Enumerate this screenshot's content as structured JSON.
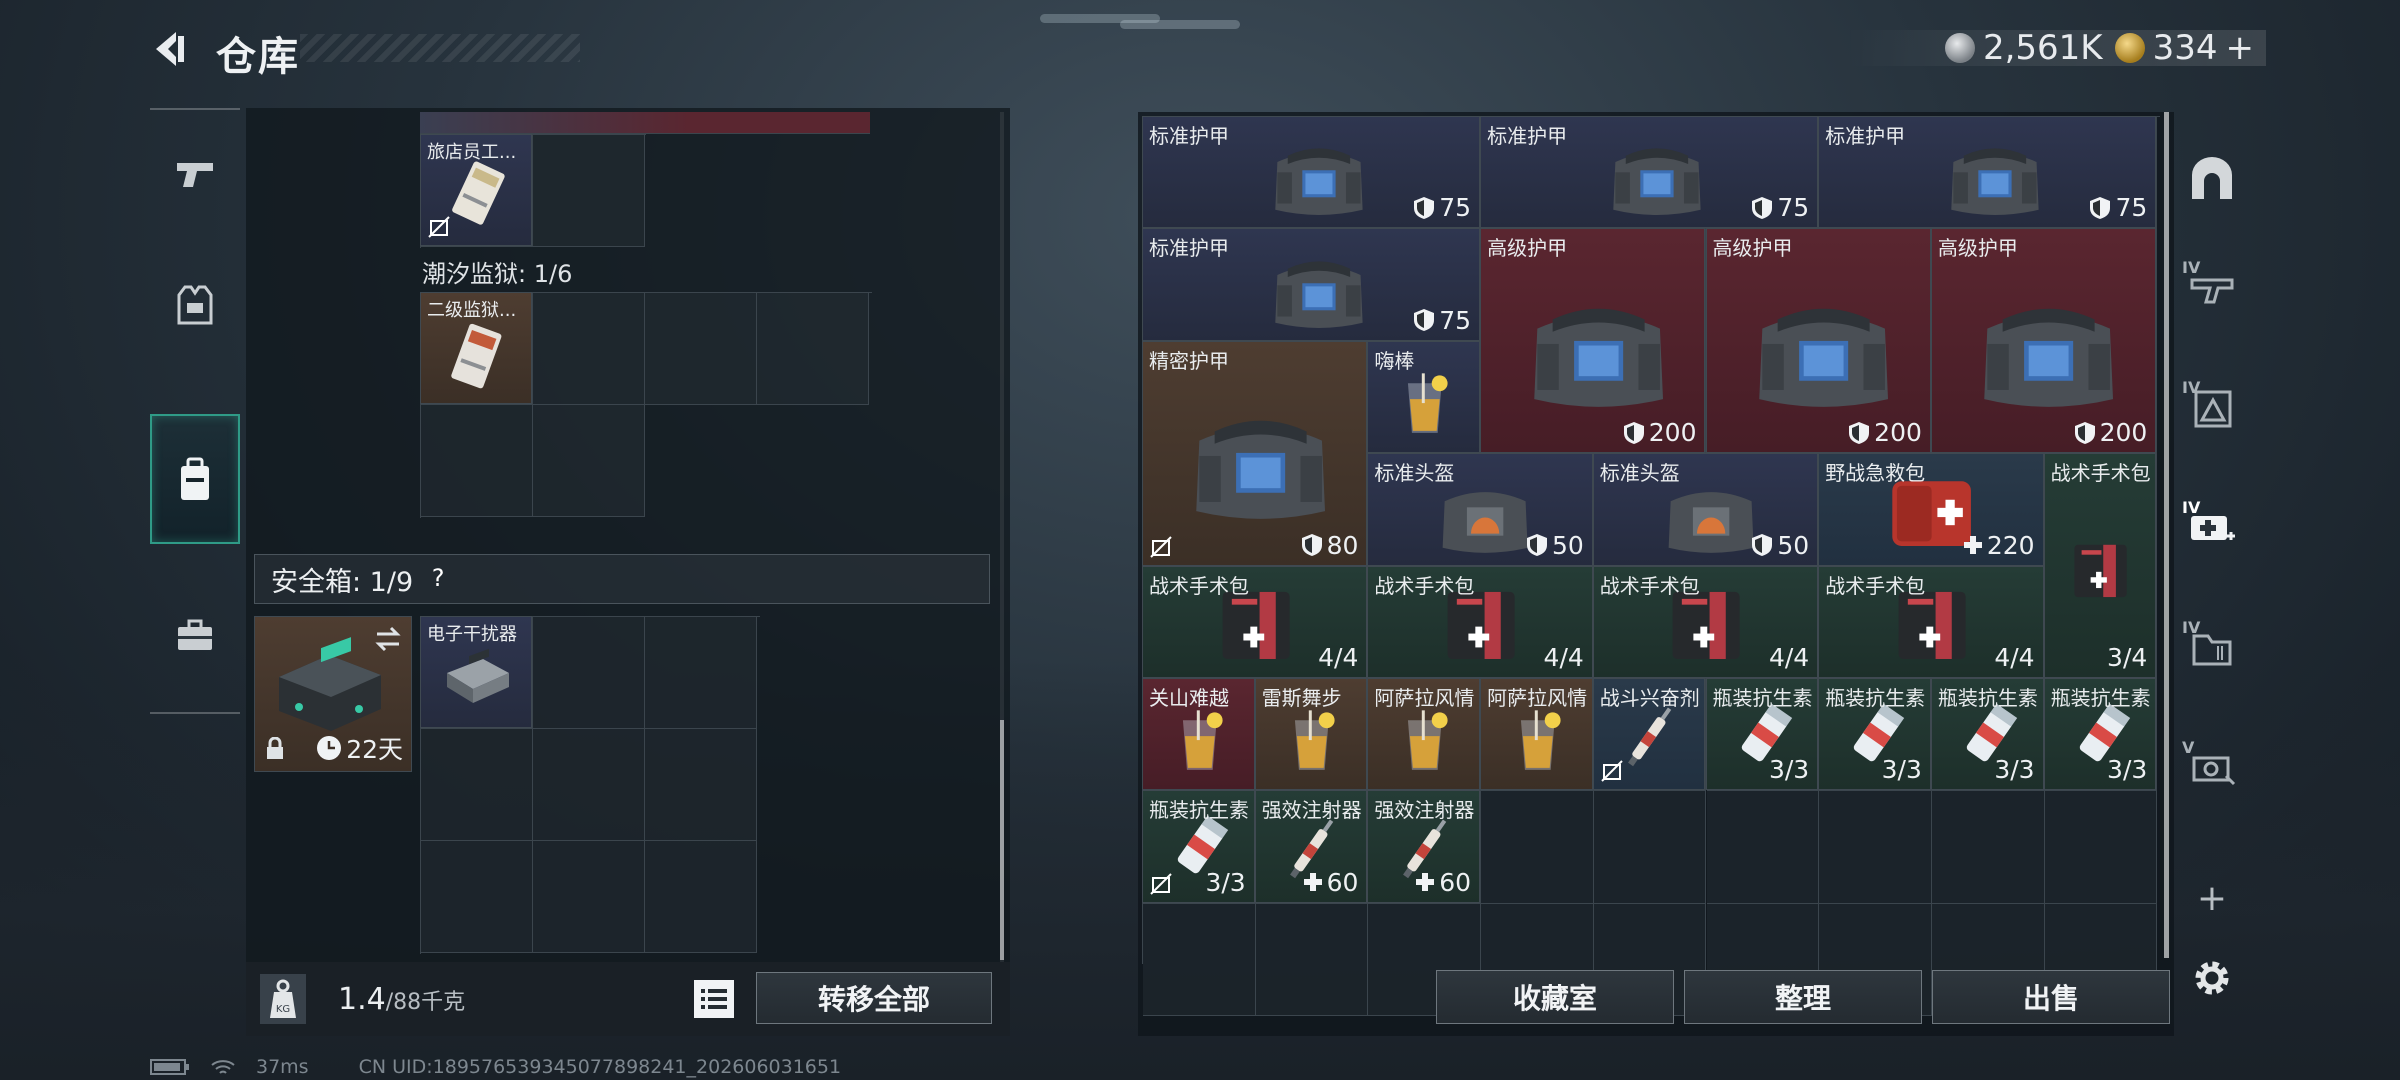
{
  "header": {
    "title": "仓库",
    "currency_silver": "2,561K",
    "currency_gold": "334",
    "add_symbol": "+"
  },
  "left_sidebar": {
    "tabs": [
      {
        "key": "weapons",
        "icon": "pistol-icon"
      },
      {
        "key": "gear",
        "icon": "vest-icon"
      },
      {
        "key": "backpack",
        "icon": "backpack-icon",
        "active": true
      },
      {
        "key": "case",
        "icon": "briefcase-icon"
      }
    ]
  },
  "left_panel": {
    "items": [
      {
        "name": "旅店员工..."
      },
      {
        "name": "二级监狱..."
      }
    ],
    "prison_section": "潮汐监狱: 1/6",
    "safe_box": {
      "label": "安全箱: 1/9",
      "help": "?",
      "duration": "22天",
      "item_name": "电子干扰器"
    },
    "weight_value": "1.4",
    "weight_total": "/88千克",
    "transfer_all": "转移全部"
  },
  "right_panel": {
    "items": [
      {
        "name": "标准护甲",
        "value": "75",
        "kind": "armor",
        "bg": "blue"
      },
      {
        "name": "标准护甲",
        "value": "75",
        "kind": "armor",
        "bg": "blue"
      },
      {
        "name": "标准护甲",
        "value": "75",
        "kind": "armor",
        "bg": "blue"
      },
      {
        "name": "标准护甲",
        "value": "75",
        "kind": "armor",
        "bg": "blue"
      },
      {
        "name": "高级护甲",
        "value": "200",
        "kind": "armor",
        "bg": "red"
      },
      {
        "name": "高级护甲",
        "value": "200",
        "kind": "armor",
        "bg": "red"
      },
      {
        "name": "高级护甲",
        "value": "200",
        "kind": "armor",
        "bg": "red"
      },
      {
        "name": "精密护甲",
        "value": "80",
        "kind": "armor",
        "bg": "brown"
      },
      {
        "name": "嗨棒",
        "value": "",
        "kind": "drink",
        "bg": "blue"
      },
      {
        "name": "标准头盔",
        "value": "50",
        "kind": "helmet",
        "bg": "blue"
      },
      {
        "name": "标准头盔",
        "value": "50",
        "kind": "helmet",
        "bg": "blue"
      },
      {
        "name": "野战急救包",
        "value": "220",
        "kind": "medkit",
        "bg": "steel"
      },
      {
        "name": "战术手术包",
        "value": "3/4",
        "kind": "surgkit",
        "bg": "green"
      },
      {
        "name": "战术手术包",
        "value": "4/4",
        "kind": "surgkit",
        "bg": "green"
      },
      {
        "name": "战术手术包",
        "value": "4/4",
        "kind": "surgkit",
        "bg": "green"
      },
      {
        "name": "战术手术包",
        "value": "4/4",
        "kind": "surgkit",
        "bg": "green"
      },
      {
        "name": "战术手术包",
        "value": "4/4",
        "kind": "surgkit",
        "bg": "green"
      },
      {
        "name": "关山难越",
        "value": "",
        "kind": "drink",
        "bg": "red"
      },
      {
        "name": "雷斯舞步",
        "value": "",
        "kind": "drink",
        "bg": "brown"
      },
      {
        "name": "阿萨拉风情",
        "value": "",
        "kind": "drink",
        "bg": "brown"
      },
      {
        "name": "阿萨拉风情",
        "value": "",
        "kind": "drink",
        "bg": "brown"
      },
      {
        "name": "战斗兴奋剂",
        "value": "",
        "kind": "syringe",
        "bg": "steel"
      },
      {
        "name": "瓶装抗生素",
        "value": "3/3",
        "kind": "bottle",
        "bg": "green"
      },
      {
        "name": "瓶装抗生素",
        "value": "3/3",
        "kind": "bottle",
        "bg": "green"
      },
      {
        "name": "瓶装抗生素",
        "value": "3/3",
        "kind": "bottle",
        "bg": "green"
      },
      {
        "name": "瓶装抗生素",
        "value": "3/3",
        "kind": "bottle",
        "bg": "green"
      },
      {
        "name": "瓶装抗生素",
        "value": "3/3",
        "kind": "bottle",
        "bg": "green"
      },
      {
        "name": "强效注射器",
        "value": "60",
        "kind": "syringe",
        "bg": "green"
      },
      {
        "name": "强效注射器",
        "value": "60",
        "kind": "syringe",
        "bg": "green"
      }
    ],
    "buttons": {
      "collection": "收藏室",
      "organize": "整理",
      "sell": "出售"
    }
  },
  "right_sidebar": {
    "tabs": [
      {
        "key": "arch",
        "icon": "arch-icon",
        "level": ""
      },
      {
        "key": "gun-iv",
        "icon": "rifle-icon",
        "level": "IV"
      },
      {
        "key": "vest-iv",
        "icon": "vest-icon",
        "level": "IV"
      },
      {
        "key": "med-iv",
        "icon": "medical-icon",
        "level": "IV"
      },
      {
        "key": "folder-iv",
        "icon": "folder-icon",
        "level": "IV"
      },
      {
        "key": "device-v",
        "icon": "device-icon",
        "level": "V"
      }
    ],
    "add": "+"
  },
  "status": {
    "ping": "37ms",
    "uid": "CN UID:18957653934507789824​1_202606031651"
  }
}
